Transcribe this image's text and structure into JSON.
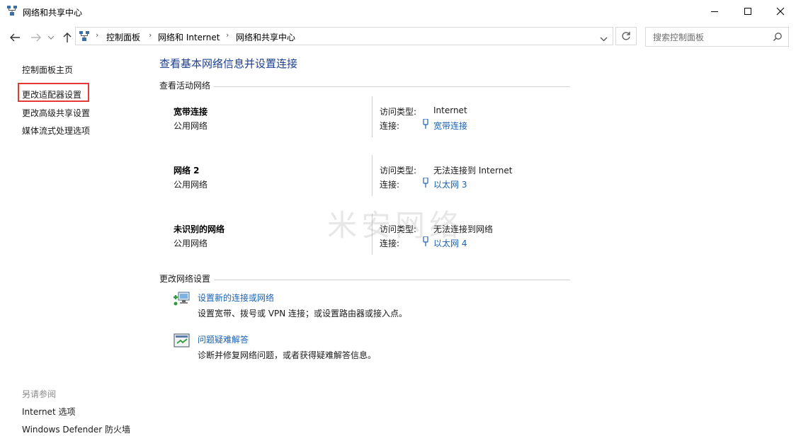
{
  "window": {
    "title": "网络和共享中心"
  },
  "nav": {
    "breadcrumb": [
      "控制面板",
      "网络和 Internet",
      "网络和共享中心"
    ],
    "search_placeholder": "搜索控制面板"
  },
  "sidebar": {
    "items": [
      {
        "label": "控制面板主页"
      },
      {
        "label": "更改适配器设置"
      },
      {
        "label": "更改高级共享设置"
      },
      {
        "label": "媒体流式处理选项"
      }
    ],
    "see_also_label": "另请参阅",
    "see_also": [
      {
        "label": "Internet 选项"
      },
      {
        "label": "Windows Defender 防火墙"
      }
    ]
  },
  "main": {
    "title": "查看基本网络信息并设置连接",
    "active_networks_header": "查看活动网络",
    "access_type_label": "访问类型:",
    "connection_label": "连接:",
    "networks": [
      {
        "name": "宽带连接",
        "type": "公用网络",
        "access": "Internet",
        "connection": "宽带连接"
      },
      {
        "name": "网络 2",
        "type": "公用网络",
        "access": "无法连接到 Internet",
        "connection": "以太网 3"
      },
      {
        "name": "未识别的网络",
        "type": "公用网络",
        "access": "无法连接到网络",
        "connection": "以太网 4"
      }
    ],
    "change_settings_header": "更改网络设置",
    "tasks": [
      {
        "link": "设置新的连接或网络",
        "desc": "设置宽带、拨号或 VPN 连接；或设置路由器或接入点。"
      },
      {
        "link": "问题疑难解答",
        "desc": "诊断并修复网络问题，或者获得疑难解答信息。"
      }
    ]
  },
  "watermark": "米安网络"
}
